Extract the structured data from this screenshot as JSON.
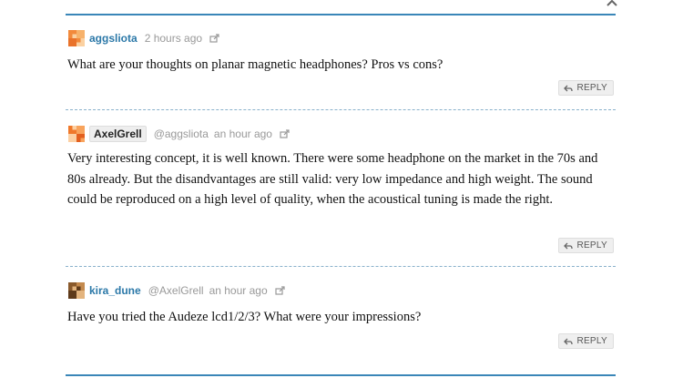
{
  "comments": [
    {
      "author": "aggsliota",
      "mention": "",
      "time": "2 hours ago",
      "body": "What are your thoughts on planar magnetic headphones? Pros vs cons?",
      "reply_label": "REPLY",
      "avatar_colors": [
        "#f28a3c",
        "#f7b26b",
        "#e9722a",
        "#fbd1a1"
      ]
    },
    {
      "author": "AxelGrell",
      "mention": "@aggsliota",
      "time": "an hour ago",
      "body": "Very interesting concept, it is well known. There were some headphone on the market in the 70s and 80s already. But the disandvantages are still valid: very low impedance and high weight. The sound could be reproduced on a high level of quality, when the acoustical tuning is made the right.",
      "reply_label": "REPLY",
      "avatar_colors": [
        "#f0782a",
        "#f8a35c",
        "#fcd0a3",
        "#e35f1e"
      ]
    },
    {
      "author": "kira_dune",
      "mention": "@AxelGrell",
      "time": "an hour ago",
      "body": "Have you tried the Audeze lcd1/2/3? What were your impressions?",
      "reply_label": "REPLY",
      "avatar_colors": [
        "#8a5a2c",
        "#c48a4e",
        "#5e3a1a",
        "#e3b47e"
      ]
    }
  ],
  "colors": {
    "accent": "#3a86b8",
    "author_link": "#2b78a8",
    "meta_text": "#999999",
    "separator": "#8ab2cc"
  }
}
